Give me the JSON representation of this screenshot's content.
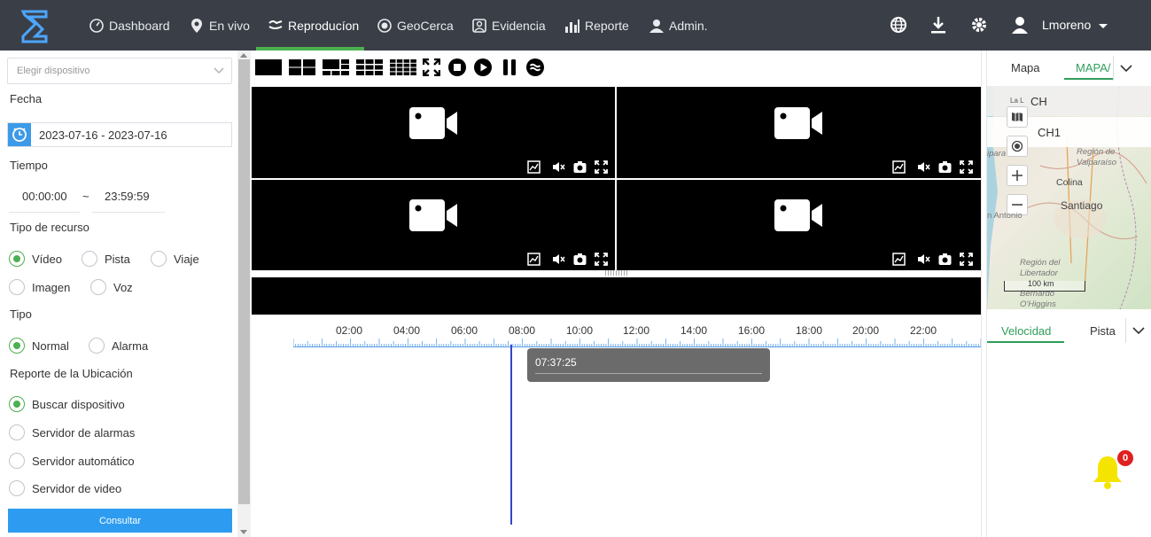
{
  "nav": {
    "items": [
      {
        "label": "Dashboard",
        "icon": "dashboard-icon"
      },
      {
        "label": "En vivo",
        "icon": "location-pin-icon"
      },
      {
        "label": "Reproducíon",
        "icon": "playback-icon"
      },
      {
        "label": "GeoCerca",
        "icon": "geofence-icon"
      },
      {
        "label": "Evidencia",
        "icon": "evidence-icon"
      },
      {
        "label": "Reporte",
        "icon": "bar-chart-icon"
      },
      {
        "label": "Admin.",
        "icon": "admin-icon"
      }
    ],
    "active_index": 2,
    "user": "Lmoreno",
    "accent": "#4cb050",
    "bar_color": "#3a3f47"
  },
  "left": {
    "device_placeholder": "Elegir dispositivo",
    "fecha_label": "Fecha",
    "date_range": "2023-07-16 - 2023-07-16",
    "tiempo_label": "Tiempo",
    "time_start": "00:00:00",
    "time_sep": "~",
    "time_end": "23:59:59",
    "tipo_recurso_label": "Tipo de recurso",
    "recurso_options": [
      "Vídeo",
      "Pista",
      "Viaje",
      "Imagen",
      "Voz"
    ],
    "recurso_selected": "Vídeo",
    "tipo_label": "Tipo",
    "tipo_options": [
      "Normal",
      "Alarma"
    ],
    "tipo_selected": "Normal",
    "ubicacion_label": "Reporte de la Ubicación",
    "ubicacion_options": [
      "Buscar dispositivo",
      "Servidor de alarmas",
      "Servidor automático",
      "Servidor de video"
    ],
    "ubicacion_selected": "Buscar dispositivo",
    "consultar_label": "Consultar"
  },
  "toolbar": {
    "icons": [
      "layout-1-icon",
      "layout-4-icon",
      "layout-6-icon",
      "layout-9-icon",
      "layout-16-icon",
      "fullscreen-icon",
      "stop-icon",
      "play-icon",
      "pause-icon",
      "speed-icon"
    ]
  },
  "video": {
    "tiles": 4,
    "controls": [
      "snapshot-frame-icon",
      "mute-icon",
      "camera-icon",
      "expand-icon"
    ]
  },
  "timeline": {
    "hours": [
      "02:00",
      "04:00",
      "06:00",
      "08:00",
      "10:00",
      "12:00",
      "14:00",
      "16:00",
      "18:00",
      "20:00",
      "22:00"
    ],
    "tooltip_time": "07:37:25",
    "cursor_fraction": 0.317
  },
  "right": {
    "tab_map": "Mapa",
    "tab_mapa2": "MAPA/",
    "ch_header": "CH",
    "ch_prefix": "La L",
    "ch1": "CH1",
    "map_labels": {
      "region_valparaiso_1": "Región de",
      "region_valparaiso_2": "Valparaíso",
      "colina": "Colina",
      "santiago": "Santiago",
      "san_antonio": "n Antonio",
      "ipara": "ipara",
      "region_lib_1": "Región del",
      "region_lib_2": "Libertador",
      "region_lib_3": "Bernardo",
      "region_lib_4": "O'Higgins",
      "scale": "100 km"
    },
    "tab_velocidad": "Velocidad",
    "tab_pista": "Pista"
  },
  "notifications": {
    "count": "0"
  }
}
